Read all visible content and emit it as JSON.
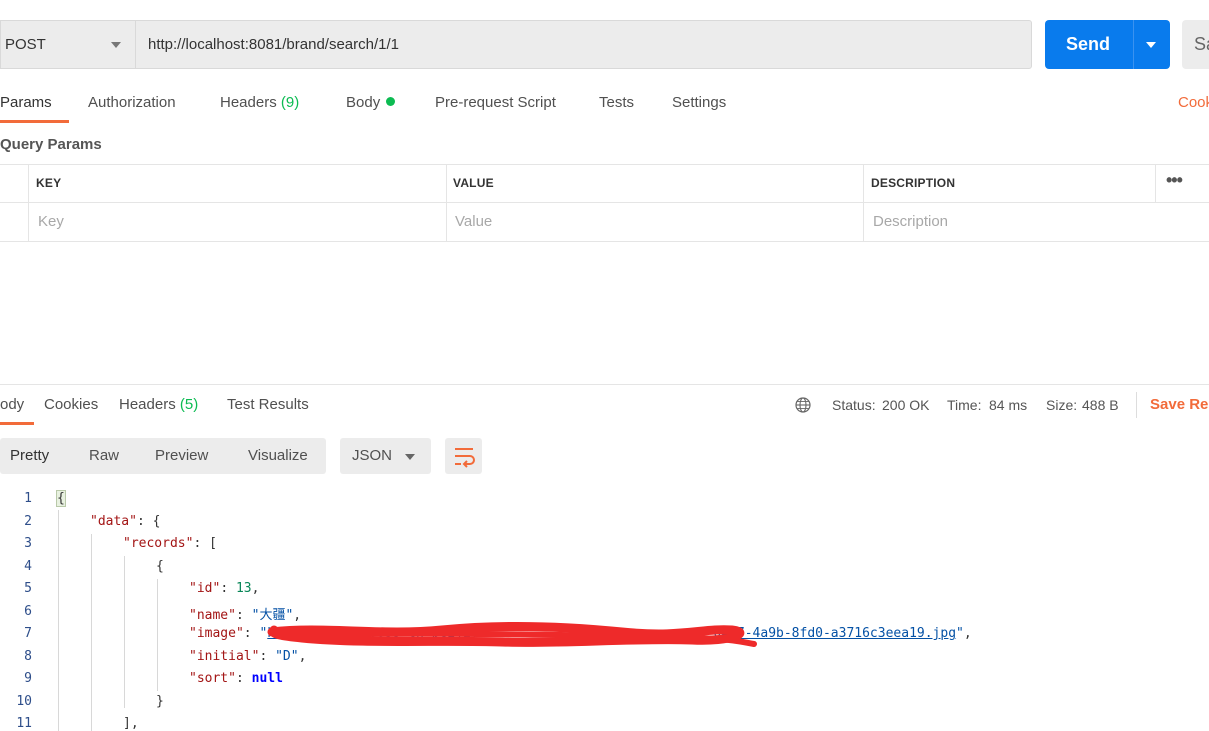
{
  "request": {
    "method": "POST",
    "url": "http://localhost:8081/brand/search/1/1",
    "send_label": "Send",
    "save_label": "Sa"
  },
  "request_tabs": {
    "params": "Params",
    "authorization": "Authorization",
    "headers": "Headers",
    "headers_count": "(9)",
    "body": "Body",
    "pre_request": "Pre-request Script",
    "tests": "Tests",
    "settings": "Settings",
    "cookies": "Cook"
  },
  "query_params": {
    "title": "Query Params",
    "columns": [
      "KEY",
      "VALUE",
      "DESCRIPTION"
    ],
    "placeholders": [
      "Key",
      "Value",
      "Description"
    ]
  },
  "response_tabs": {
    "body": "ody",
    "cookies": "Cookies",
    "headers": "Headers",
    "headers_count": "(5)",
    "test_results": "Test Results"
  },
  "response_status": {
    "status_label": "Status:",
    "status_value": "200 OK",
    "time_label": "Time:",
    "time_value": "84 ms",
    "size_label": "Size:",
    "size_value": "488 B",
    "save_response": "Save Res"
  },
  "view_modes": [
    "Pretty",
    "Raw",
    "Preview",
    "Visualize"
  ],
  "format": "JSON",
  "code": {
    "line_numbers": [
      "1",
      "2",
      "3",
      "4",
      "5",
      "6",
      "7",
      "8",
      "9",
      "10",
      "11"
    ],
    "id_value": "13",
    "name_value": "\"大疆\"",
    "image_value_visible": "8-0487-4a9b-8fd0-a3716c3eea19.jpg",
    "image_value_obscured": "https://skill.oss-cn-beiji.............................",
    "initial_value": "\"D\"",
    "sort_value": "null"
  },
  "colors": {
    "accent_orange": "#f26b3a",
    "send_blue": "#097bed",
    "status_green": "#0cbb52",
    "scribble_red": "#ee2a2a"
  }
}
